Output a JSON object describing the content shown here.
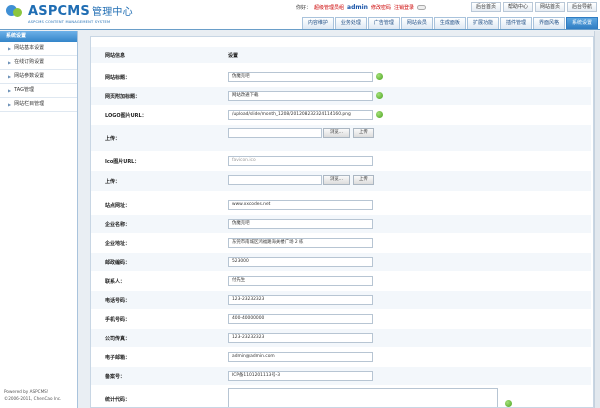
{
  "header": {
    "logo_name": "ASPCMS",
    "logo_cn": "管理中心",
    "logo_sub": "ASPCMS CONTENT MANAGEMENT SYSTEM",
    "greeting": "你好：",
    "role": "超级管理员组",
    "username": "admin",
    "change_password": "修改密码",
    "logout": "注销登录",
    "toplinks": [
      "后台首页",
      "帮助中心",
      "网站首页",
      "后台导航"
    ],
    "tabs": [
      "内容维护",
      "业务处理",
      "广告管理",
      "网站会员",
      "生成面板",
      "扩展功能",
      "插件管理",
      "界面风格",
      "系统设置"
    ],
    "active_tab": "系统设置"
  },
  "sidebar": {
    "title": "系统设置",
    "items": [
      "网站基本设置",
      "在线订购设置",
      "网站参数设置",
      "TAG管理",
      "网站栏目管理"
    ],
    "footer_1": "Powered by ASPCMS!",
    "footer_2": "©2006-2011, ChenCao Inc."
  },
  "form": {
    "col_info": "网站信息",
    "col_setting": "设置",
    "site_title_label": "网站标题：",
    "site_title_value": "伪魔克吧",
    "site_extra_title_label": "网页附加标题：",
    "site_extra_title_value": "网站改通下载",
    "logo_url_label": "LOGO图片URL：",
    "logo_url_value": "/upload/slide/month_1208/201208232324114160.png",
    "upload_label": "上传：",
    "browse_label": "浏览...",
    "upload_button": "上传",
    "ico_url_label": "Ico图片URL：",
    "ico_url_value": "favicon.ico",
    "upload2_label": "上传：",
    "site_url_label": "站点网址：",
    "site_url_value": "www.xxcodes.net",
    "company_label": "企业名称：",
    "company_value": "伪魔克吧",
    "address_label": "企业地址：",
    "address_value": "东莞市南城区鸿福路海关楼广场 2 栋",
    "zip_label": "邮政编码：",
    "zip_value": "523000",
    "contact_label": "联系人：",
    "contact_value": "付先生",
    "phone_label": "电话号码：",
    "phone_value": "123-23232323",
    "mobile_label": "手机号码：",
    "mobile_value": "400-40000000",
    "fax_label": "公司传真：",
    "fax_value": "123-23232323",
    "email_label": "电子邮箱：",
    "email_value": "admin@admin.com",
    "icp_label": "备案号：",
    "icp_value": "ICP备1101201113号-3",
    "stats_label": "统计代码："
  }
}
